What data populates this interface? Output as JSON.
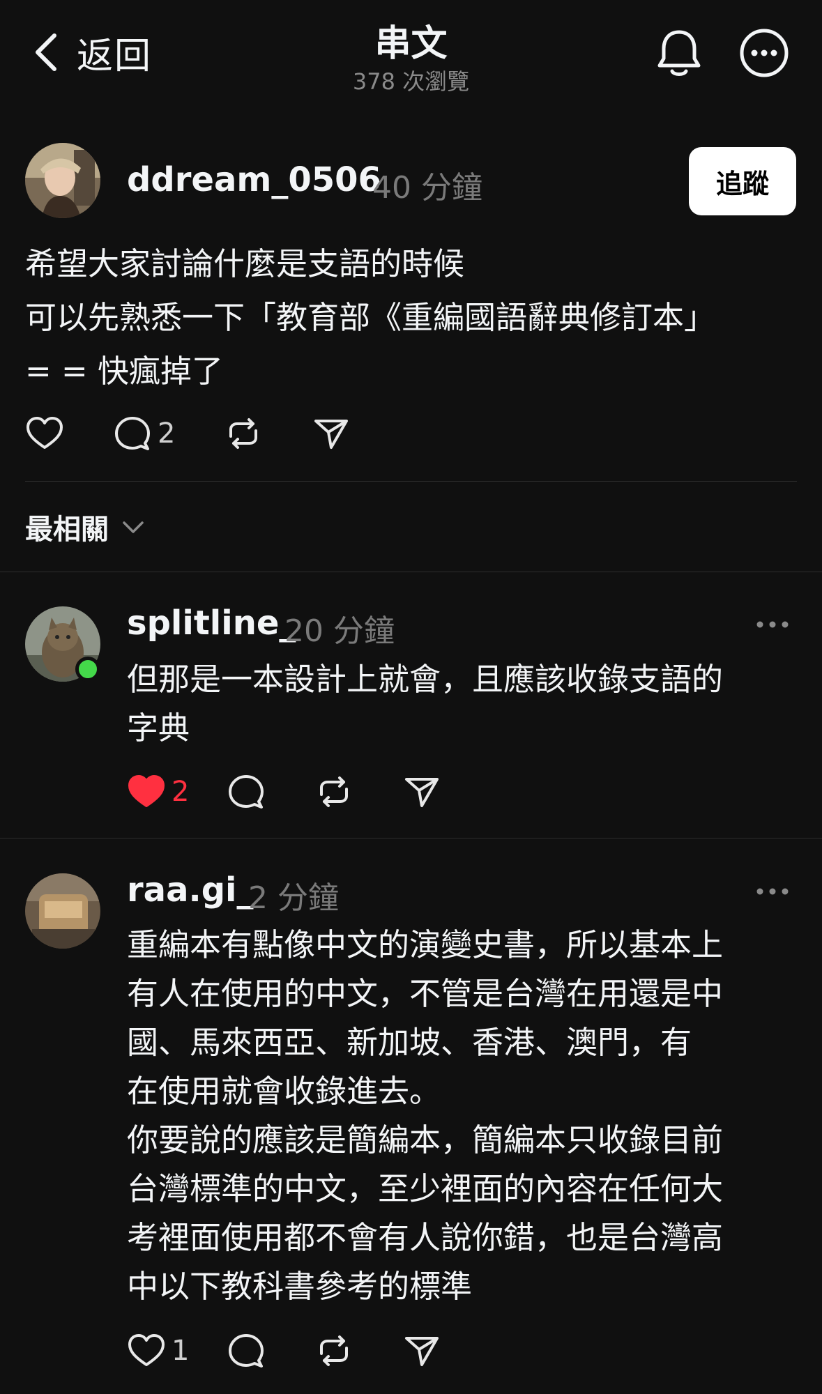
{
  "header": {
    "back_label": "返回",
    "title": "串文",
    "subtitle": "378 次瀏覽",
    "bell_icon": "bell-icon",
    "more_icon": "more-circle-icon"
  },
  "post": {
    "username": "ddream_0506",
    "time": "40 分鐘",
    "follow_label": "追蹤",
    "lines": [
      "希望大家討論什麼是支語的時候",
      "可以先熟悉一下「教育部《重編國語辭典修訂本」",
      "= = 快瘋掉了"
    ],
    "comment_count": "2"
  },
  "sort": {
    "label": "最相關"
  },
  "replies": [
    {
      "username": "splitline_",
      "time": "20 分鐘",
      "online": true,
      "lines": [
        "但那是一本設計上就會，且應該收錄支語的",
        "字典"
      ],
      "like_count": "2",
      "liked": true
    },
    {
      "username": "raa.gi_",
      "time": "2 分鐘",
      "online": false,
      "lines": [
        "重編本有點像中文的演變史書，所以基本上",
        "有人在使用的中文，不管是台灣在用還是中",
        "國、馬來西亞、新加坡、香港、澳門，有",
        "在使用就會收錄進去。",
        "你要說的應該是簡編本，簡編本只收錄目前",
        "台灣標準的中文，至少裡面的內容在任何大",
        "考裡面使用都不會有人說你錯，也是台灣高",
        "中以下教科書參考的標準"
      ],
      "like_count": "1",
      "liked": false
    }
  ],
  "colors": {
    "background": "#101010",
    "text": "#f3f5f7",
    "muted": "#7a7a7a",
    "like_red": "#ff3040",
    "online_green": "#44d94a"
  }
}
